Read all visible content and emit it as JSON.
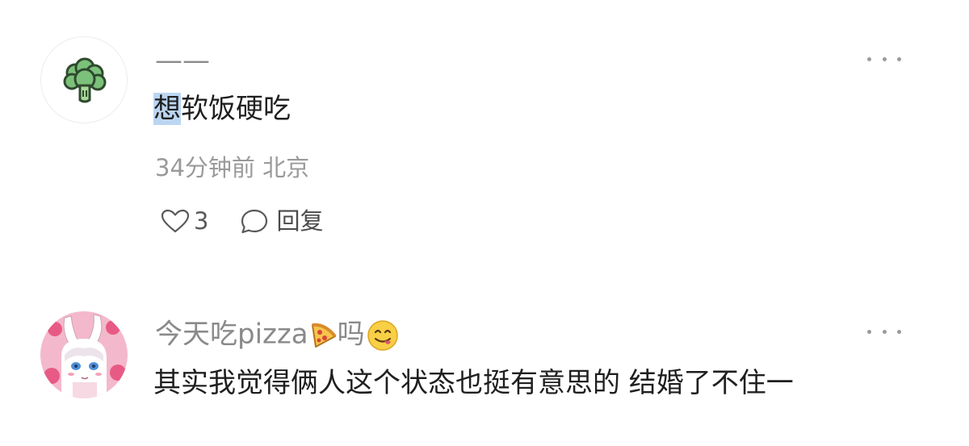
{
  "comments": [
    {
      "username": "——",
      "avatar": "broccoli-avatar",
      "content_selected": "想",
      "content_rest": "软饭硬吃",
      "time": "34分钟前",
      "location": "北京",
      "likes": "3",
      "reply_label": "回复",
      "more_icon": "more-icon"
    },
    {
      "username_text": "今天吃pizza",
      "username_emoji_1": "pizza-emoji",
      "username_mid": "吗",
      "username_emoji_2": "yum-face-emoji",
      "avatar": "bunny-girl-avatar",
      "content": "其实我觉得俩人这个状态也挺有意思的 结婚了不住一",
      "more_icon": "more-icon"
    }
  ],
  "colors": {
    "selection": "#bcd6f2",
    "muted_text": "#9a9a9a",
    "main_text": "#1f1f1f"
  }
}
